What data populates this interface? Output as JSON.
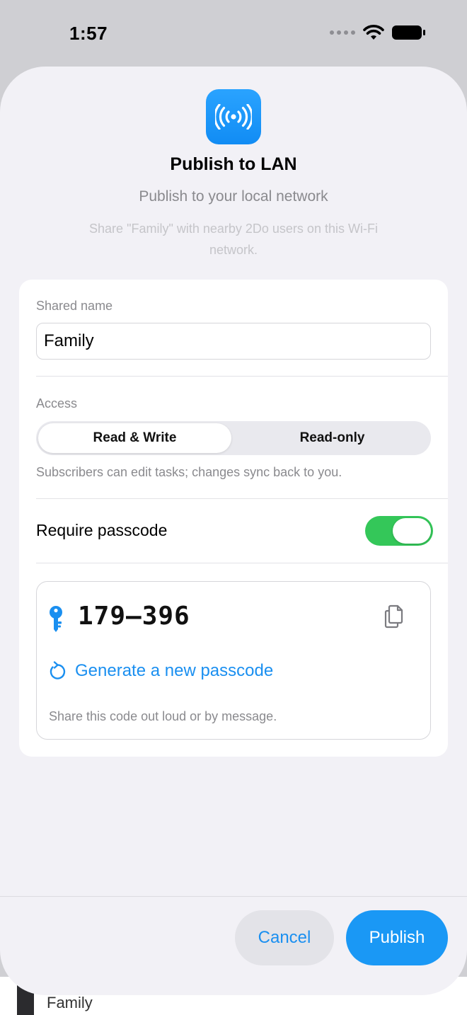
{
  "status_bar": {
    "time": "1:57",
    "icons": [
      "cellular-signal-icon",
      "wifi-icon",
      "battery-icon"
    ]
  },
  "background": {
    "peek_text": "Family"
  },
  "sheet": {
    "app_icon": "broadcast-icon",
    "title": "Publish to LAN",
    "subtitle": "Publish to your local network",
    "description": "Share \"Family\" with nearby 2Do users on this Wi-Fi network."
  },
  "form": {
    "shared_name": {
      "label": "Shared name",
      "value": "Family"
    },
    "access": {
      "label": "Access",
      "options": [
        "Read & Write",
        "Read-only"
      ],
      "selected": "Read & Write",
      "help": "Subscribers can edit tasks; changes sync back to you."
    },
    "require_passcode": {
      "label": "Require passcode",
      "enabled": true
    },
    "passcode": {
      "value": "179–396",
      "regenerate_label": "Generate a new passcode",
      "help": "Share this code out loud or by message."
    }
  },
  "footer": {
    "cancel_label": "Cancel",
    "publish_label": "Publish"
  },
  "colors": {
    "accent": "#1a8ff0",
    "toggle_on": "#34c759",
    "sheet_background": "#f2f1f6"
  }
}
